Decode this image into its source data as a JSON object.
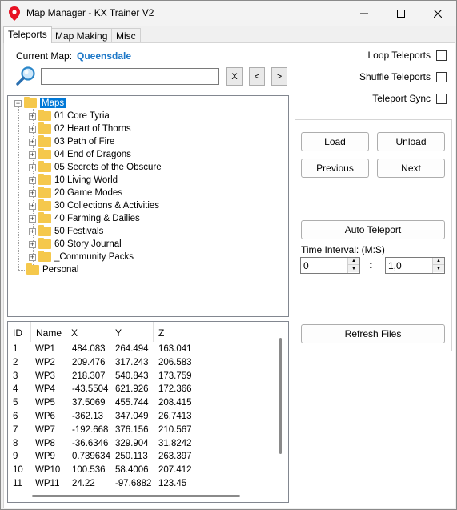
{
  "window": {
    "title": "Map Manager - KX Trainer V2",
    "icon": "map-pin-icon",
    "controls": {
      "minimize": "—",
      "maximize": "☐",
      "close": "✕"
    },
    "accent_color": "#e81123"
  },
  "tabs": [
    {
      "label": "Teleports",
      "active": true
    },
    {
      "label": "Map Making",
      "active": false
    },
    {
      "label": "Misc",
      "active": false
    }
  ],
  "current_map": {
    "label": "Current Map:",
    "value": "Queensdale",
    "color": "#1e78c8"
  },
  "search": {
    "value": "",
    "placeholder": "",
    "clear": "X",
    "prev": "<",
    "next": ">"
  },
  "options": [
    {
      "label": "Loop Teleports",
      "checked": false
    },
    {
      "label": "Shuffle Teleports",
      "checked": false
    },
    {
      "label": "Teleport Sync",
      "checked": false
    }
  ],
  "tree": {
    "root": "Maps",
    "items": [
      "01 Core Tyria",
      "02 Heart of Thorns",
      "03 Path of Fire",
      "04 End of Dragons",
      "05 Secrets of the Obscure",
      "10 Living World",
      "20 Game Modes",
      "30 Collections & Activities",
      "40 Farming & Dailies",
      "50 Festivals",
      "60 Story Journal",
      "_Community Packs"
    ],
    "other_root": "Personal",
    "selected_color": "#0078d7",
    "folder_color": "#f5c84c"
  },
  "controls": {
    "load": "Load",
    "unload": "Unload",
    "previous": "Previous",
    "next": "Next",
    "auto_teleport": "Auto Teleport",
    "interval_label": "Time Interval: (M:S)",
    "minutes": "0",
    "separator": ":",
    "seconds": "1,0",
    "refresh": "Refresh Files"
  },
  "grid": {
    "columns": [
      "ID",
      "Name",
      "X",
      "Y",
      "Z"
    ],
    "rows": [
      [
        "1",
        "WP1",
        "484.083",
        "264.494",
        "163.041"
      ],
      [
        "2",
        "WP2",
        "209.476",
        "317.243",
        "206.583"
      ],
      [
        "3",
        "WP3",
        "218.307",
        "540.843",
        "173.759"
      ],
      [
        "4",
        "WP4",
        "-43.5504",
        "621.926",
        "172.366"
      ],
      [
        "5",
        "WP5",
        "37.5069",
        "455.744",
        "208.415"
      ],
      [
        "6",
        "WP6",
        "-362.13",
        "347.049",
        "26.7413"
      ],
      [
        "7",
        "WP7",
        "-192.668",
        "376.156",
        "210.567"
      ],
      [
        "8",
        "WP8",
        "-36.6346",
        "329.904",
        "31.8242"
      ],
      [
        "9",
        "WP9",
        "0.739634",
        "250.113",
        "263.397"
      ],
      [
        "10",
        "WP10",
        "100.536",
        "58.4006",
        "207.412"
      ],
      [
        "11",
        "WP11",
        "24.22",
        "-97.6882",
        "123.45"
      ]
    ]
  }
}
